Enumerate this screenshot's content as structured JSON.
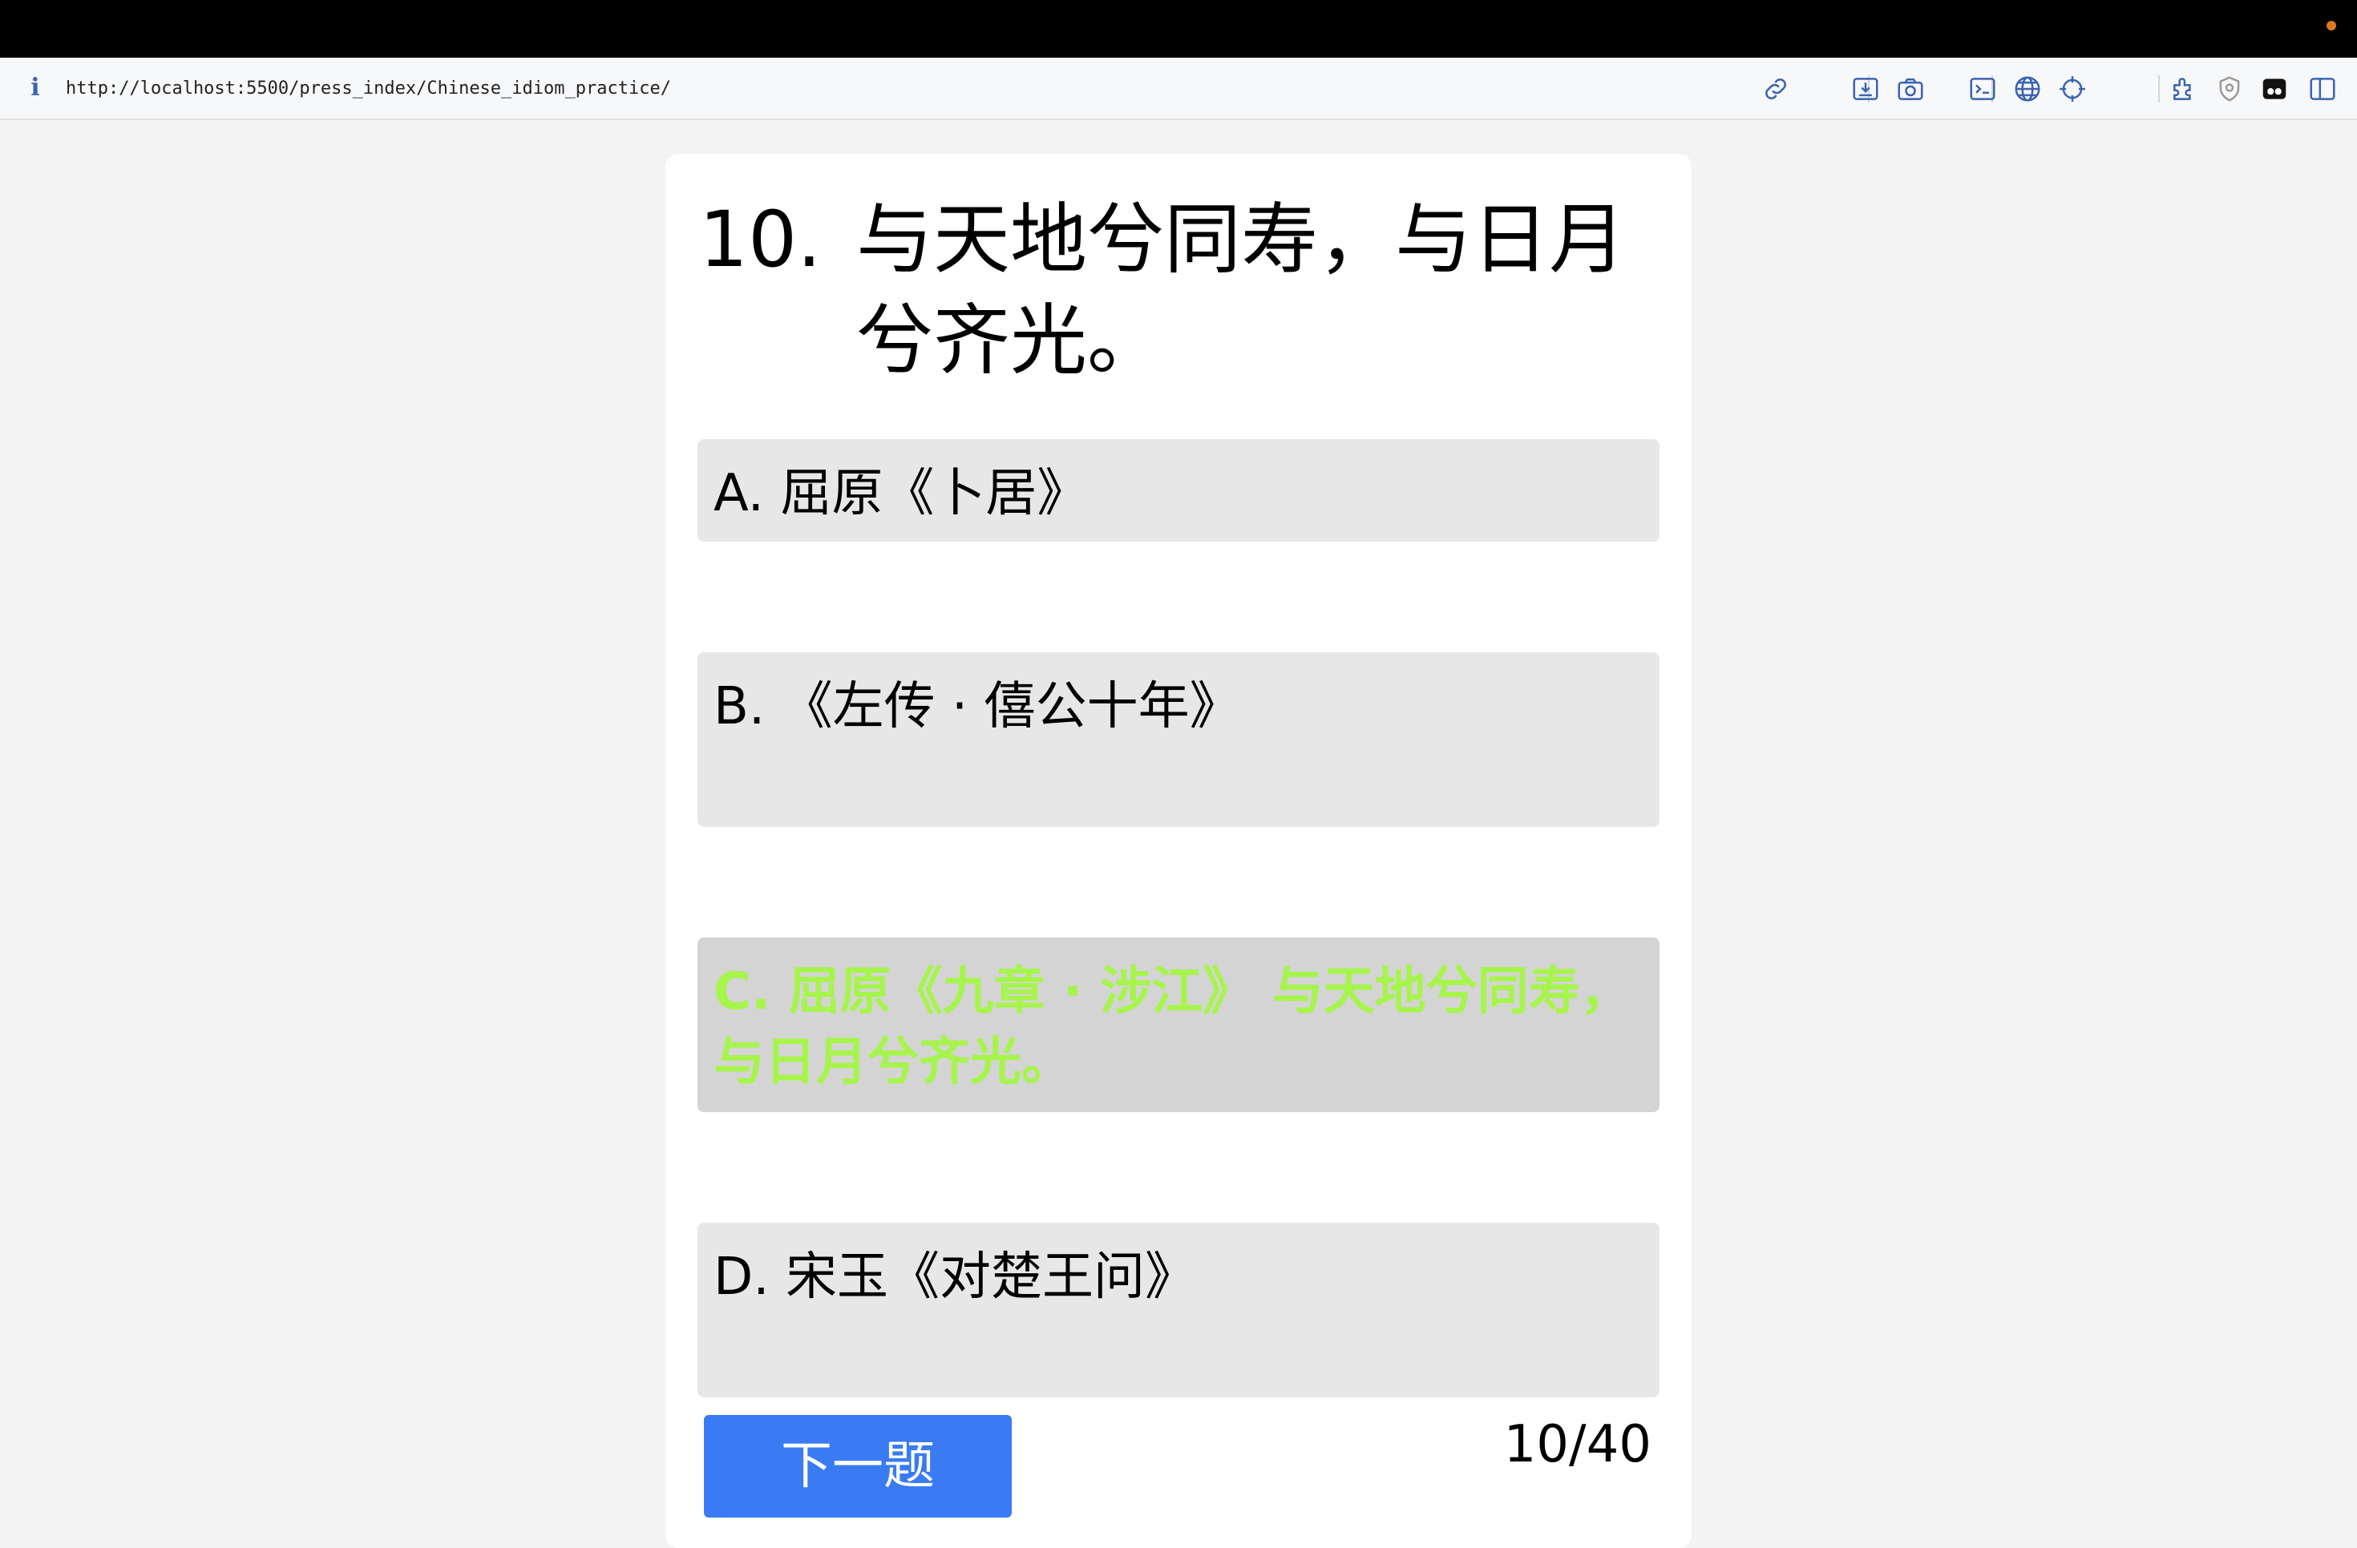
{
  "browser": {
    "url": "http://localhost:5500/press_index/Chinese_idiom_practice/",
    "toolbar_icons": [
      "link-icon",
      "download-icon",
      "camera-icon",
      "terminal-icon",
      "globe-icon",
      "crosshair-icon",
      "extensions-icon",
      "shield-icon",
      "profile-icon",
      "sidebar-icon"
    ]
  },
  "quiz": {
    "question_number": "10.",
    "question_text": "与天地兮同寿，与日月兮齐光。",
    "options": [
      {
        "label": "A. 屈原《卜居》"
      },
      {
        "label": "B. 《左传 · 僖公十年》"
      },
      {
        "label": "C. 屈原《九章 · 涉江》 与天地兮同寿，与日月兮齐光。",
        "state": "correct"
      },
      {
        "label": "D. 宋玉《对楚王问》"
      }
    ],
    "next_button_label": "下一题",
    "progress": "10/40"
  },
  "colors": {
    "next_button": "#3a7bf3",
    "correct_text": "#a6f54a",
    "option_bg": "#e7e7e7",
    "correct_option_bg": "#d4d4d4"
  }
}
